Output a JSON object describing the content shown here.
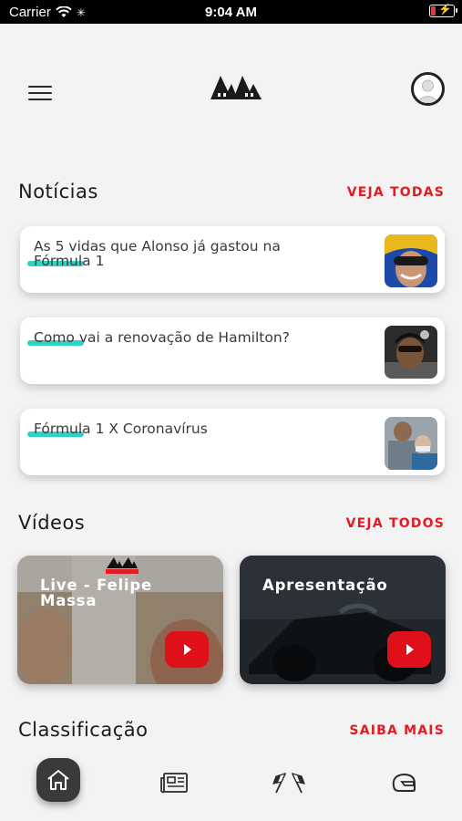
{
  "status_bar": {
    "carrier": "Carrier",
    "time": "9:04 AM"
  },
  "header": {
    "logo_icon": "mm-logo",
    "menu_icon": "hamburger-icon",
    "profile_icon": "avatar-icon"
  },
  "news": {
    "title": "Notícias",
    "link": "VEJA TODAS",
    "items": [
      {
        "text": "As 5 vidas que Alonso já gastou na Fórmula 1"
      },
      {
        "text": "Como vai a renovação de Hamilton?"
      },
      {
        "text": "Fórmula 1 X Coronavírus"
      }
    ]
  },
  "videos": {
    "title": "Vídeos",
    "link": "VEJA TODOS",
    "items": [
      {
        "title": "Live - Felipe Massa"
      },
      {
        "title": "Apresentação"
      }
    ]
  },
  "classification": {
    "title": "Classificação",
    "link": "SAIBA MAIS"
  },
  "bottom_nav": {
    "items": [
      "home-icon",
      "newspaper-icon",
      "checkered-flags-icon",
      "helmet-icon"
    ],
    "active": "home-icon"
  },
  "colors": {
    "accent": "#e31b23",
    "underline": "#2ed3c6",
    "nav_active": "#3a3a3a"
  }
}
